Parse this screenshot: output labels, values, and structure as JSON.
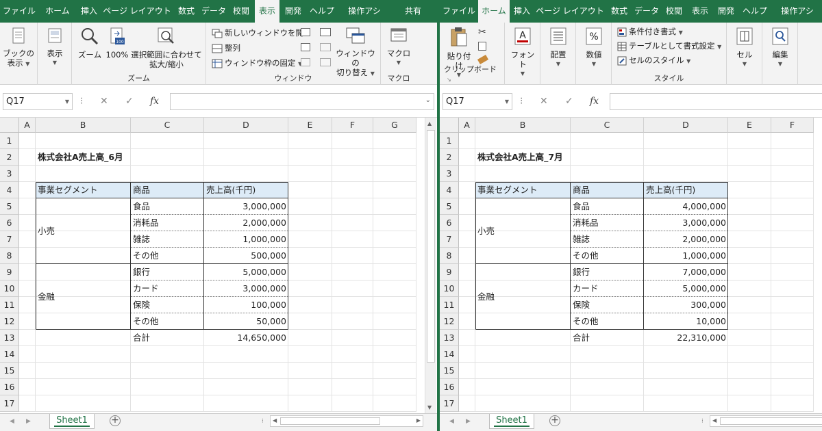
{
  "left": {
    "tabs": [
      "ファイル",
      "ホーム",
      "挿入",
      "ページ レイアウト",
      "数式",
      "データ",
      "校閲",
      "表示",
      "開発",
      "ヘルプ",
      "操作アシ",
      "共有"
    ],
    "active_tab": "表示",
    "ribbon": {
      "book_view_line1": "ブックの",
      "book_view_line2": "表示",
      "show_label": "表示",
      "zoom_label": "ズーム",
      "zoom100_label": "100%",
      "zoom_selection_line1": "選択範囲に合わせて",
      "zoom_selection_line2": "拡大/縮小",
      "zoom_group": "ズーム",
      "new_window": "新しいウィンドウを開く",
      "arrange_all": "整列",
      "freeze_panes": "ウィンドウ枠の固定",
      "switch_windows_line1": "ウィンドウの",
      "switch_windows_line2": "切り替え",
      "window_group": "ウィンドウ",
      "macro_label": "マクロ",
      "macro_group": "マクロ"
    },
    "namebox": "Q17",
    "columns": [
      "A",
      "B",
      "C",
      "D",
      "E",
      "F",
      "G"
    ],
    "rows": [
      "1",
      "2",
      "3",
      "4",
      "5",
      "6",
      "7",
      "8",
      "9",
      "10",
      "11",
      "12",
      "13",
      "14",
      "15",
      "16",
      "17"
    ],
    "sheet": {
      "title": "株式会社A売上高_6月",
      "headers": [
        "事業セグメント",
        "商品",
        "売上高(千円)"
      ],
      "segments": [
        "小売",
        "金融"
      ],
      "products": [
        "食品",
        "消耗品",
        "雑誌",
        "その他",
        "銀行",
        "カード",
        "保険",
        "その他"
      ],
      "values": [
        "3,000,000",
        "2,000,000",
        "1,000,000",
        "500,000",
        "5,000,000",
        "3,000,000",
        "100,000",
        "50,000"
      ],
      "total_label": "合計",
      "total_value": "14,650,000"
    },
    "sheet_tab": "Sheet1"
  },
  "right": {
    "tabs": [
      "ファイル",
      "ホーム",
      "挿入",
      "ページ レイアウト",
      "数式",
      "データ",
      "校閲",
      "表示",
      "開発",
      "ヘルプ",
      "操作アシ"
    ],
    "active_tab": "ホーム",
    "ribbon": {
      "paste_label": "貼り付け",
      "clipboard_group": "クリップボード",
      "font_label": "フォント",
      "alignment_label": "配置",
      "number_label": "数値",
      "conditional_format": "条件付き書式",
      "format_as_table": "テーブルとして書式設定",
      "cell_styles": "セルのスタイル",
      "style_group": "スタイル",
      "cells_label": "セル",
      "editing_label": "編集"
    },
    "namebox": "Q17",
    "columns": [
      "A",
      "B",
      "C",
      "D",
      "E",
      "F"
    ],
    "rows": [
      "1",
      "2",
      "3",
      "4",
      "5",
      "6",
      "7",
      "8",
      "9",
      "10",
      "11",
      "12",
      "13",
      "14",
      "15",
      "16",
      "17"
    ],
    "sheet": {
      "title": "株式会社A売上高_7月",
      "headers": [
        "事業セグメント",
        "商品",
        "売上高(千円)"
      ],
      "segments": [
        "小売",
        "金融"
      ],
      "products": [
        "食品",
        "消耗品",
        "雑誌",
        "その他",
        "銀行",
        "カード",
        "保険",
        "その他"
      ],
      "values": [
        "4,000,000",
        "3,000,000",
        "2,000,000",
        "1,000,000",
        "7,000,000",
        "5,000,000",
        "300,000",
        "10,000"
      ],
      "total_label": "合計",
      "total_value": "22,310,000"
    },
    "sheet_tab": "Sheet1"
  },
  "colors": {
    "excel_green": "#217346",
    "header_fill": "#ddebf7"
  }
}
